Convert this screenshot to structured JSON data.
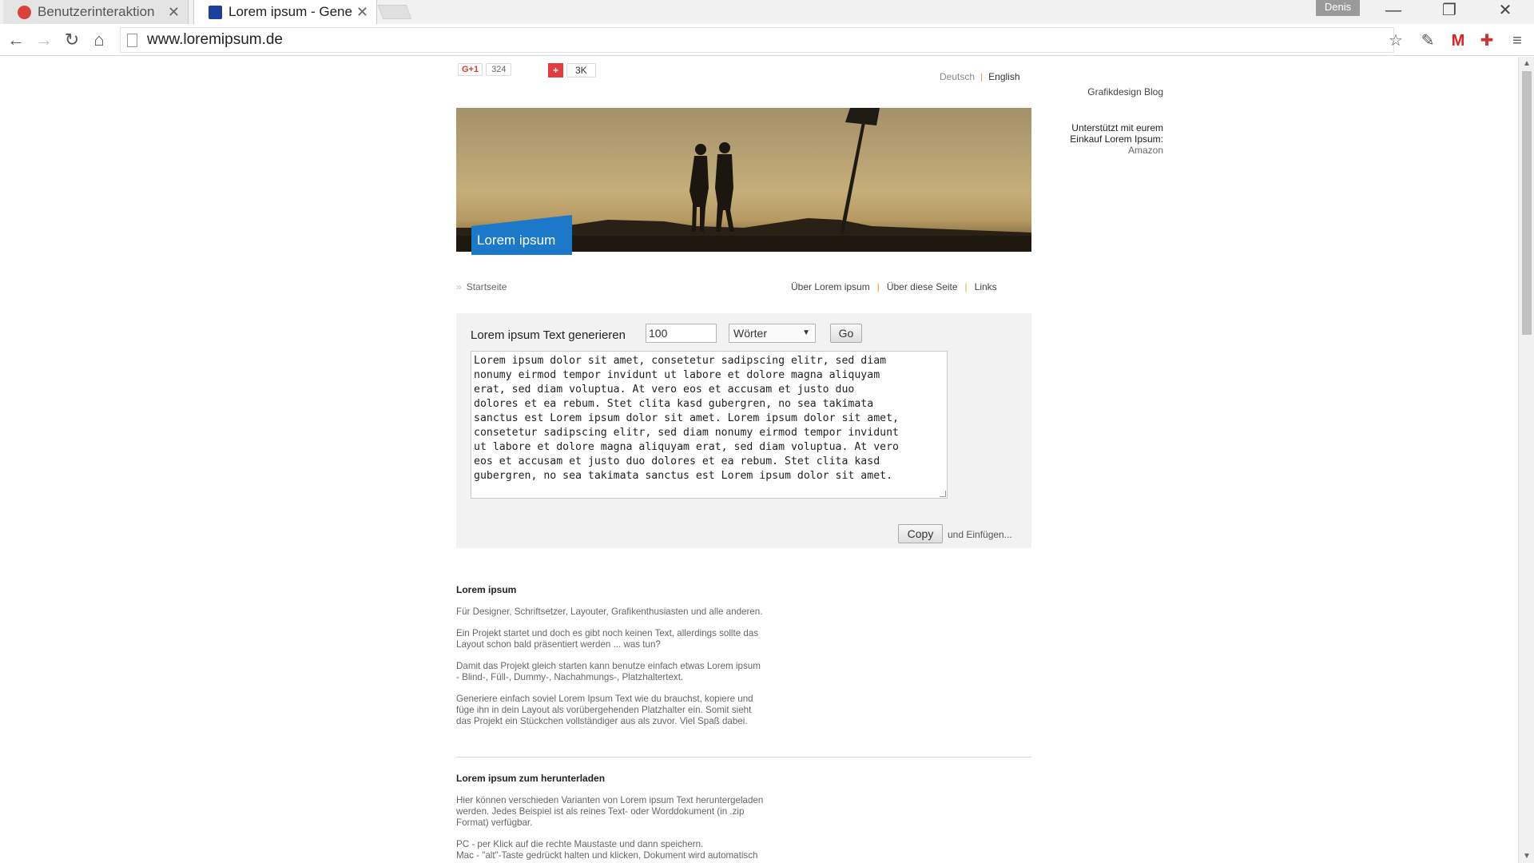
{
  "browser": {
    "tabs": [
      {
        "title": "Benutzerinteraktion",
        "active": false
      },
      {
        "title": "Lorem ipsum - Gene",
        "active": true
      }
    ],
    "profile_name": "Denis",
    "url": "www.loremipsum.de"
  },
  "social": {
    "gplus_label": "G+1",
    "gplus_count": "324",
    "share_label": "+",
    "share_count": "3K"
  },
  "languages": {
    "de": "Deutsch",
    "en": "English"
  },
  "sidebar": {
    "blog_link": "Grafikdesign Blog",
    "support_line1": "Unterstützt mit eurem",
    "support_line2": "Einkauf Lorem Ipsum:",
    "support_vendor": "Amazon"
  },
  "banner": {
    "title": "Lorem ipsum"
  },
  "breadcrumb": {
    "home": "Startseite"
  },
  "nav": {
    "items": [
      "Über Lorem ipsum",
      "Über diese Seite",
      "Links"
    ]
  },
  "generator": {
    "label": "Lorem ipsum Text generieren",
    "count_value": "100",
    "unit_selected": "Wörter",
    "go_label": "Go",
    "output_text": "Lorem ipsum dolor sit amet, consetetur sadipscing elitr, sed diam\nnonumy eirmod tempor invidunt ut labore et dolore magna aliquyam\nerat, sed diam voluptua. At vero eos et accusam et justo duo\ndolores et ea rebum. Stet clita kasd gubergren, no sea takimata\nsanctus est Lorem ipsum dolor sit amet. Lorem ipsum dolor sit amet,\nconsetetur sadipscing elitr, sed diam nonumy eirmod tempor invidunt\nut labore et dolore magna aliquyam erat, sed diam voluptua. At vero\neos et accusam et justo duo dolores et ea rebum. Stet clita kasd\ngubergren, no sea takimata sanctus est Lorem ipsum dolor sit amet.",
    "copy_label": "Copy",
    "copy_hint": "und Einfügen..."
  },
  "about": {
    "heading": "Lorem ipsum",
    "p1": "Für Designer, Schriftsetzer, Layouter, Grafikenthusiasten und alle anderen.",
    "p2a": "Ein Projekt startet und doch es gibt noch keinen Text, allerdings sollte das",
    "p2b": "Layout schon bald präsentiert werden ... was tun?",
    "p3a": "Damit das Projekt gleich starten kann benutze einfach etwas Lorem ipsum",
    "p3b": "- Blind-, Füll-, Dummy-, Nachahmungs-, Platzhaltertext.",
    "p4a": "Generiere einfach soviel Lorem Ipsum Text wie du brauchst, kopiere und",
    "p4b": "füge ihn in dein Layout als vorübergehenden Platzhalter ein. Somit sieht",
    "p4c": "das Projekt ein Stückchen vollständiger aus als zuvor. Viel Spaß dabei."
  },
  "download": {
    "heading": "Lorem ipsum zum herunterladen",
    "p1a": "Hier können verschieden Varianten von Lorem ipsum Text heruntergeladen",
    "p1b": "werden. Jedes Beispiel ist als reines Text- oder Worddokument (in .zip",
    "p1c": "Format) verfügbar.",
    "p2a": "PC - per Klick auf die rechte Maustaste und dann speichern.",
    "p2b": "Mac - \"alt\"-Taste gedrückt halten und klicken, Dokument wird automatisch"
  }
}
